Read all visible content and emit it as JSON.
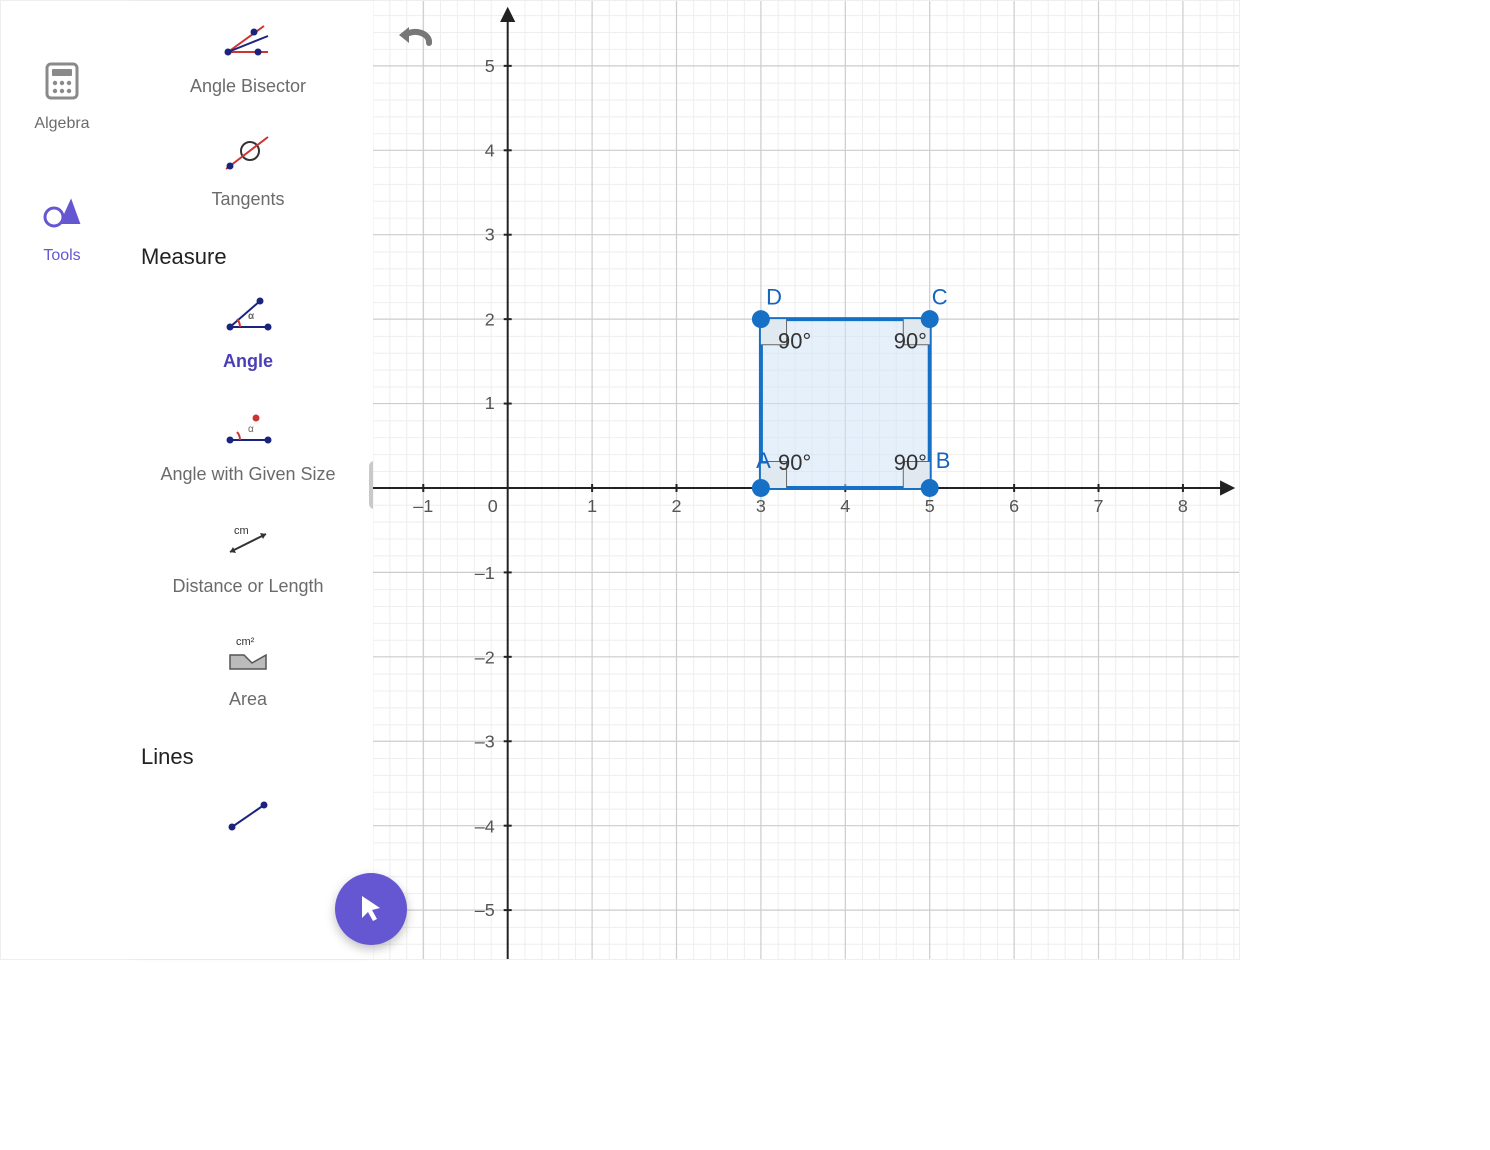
{
  "nav": {
    "algebra_label": "Algebra",
    "tools_label": "Tools"
  },
  "tools_panel": {
    "angle_bisector": "Angle Bisector",
    "tangents": "Tangents",
    "section_measure": "Measure",
    "angle": "Angle",
    "angle_with_given_size": "Angle with Given Size",
    "distance_or_length": "Distance or Length",
    "area": "Area",
    "section_lines": "Lines",
    "segment": "Segment"
  },
  "canvas": {
    "points": {
      "A": "A",
      "B": "B",
      "C": "C",
      "D": "D"
    },
    "angles": {
      "A": "90°",
      "B": "90°",
      "C": "90°",
      "D": "90°"
    },
    "x_ticks": [
      "–1",
      "0",
      "1",
      "2",
      "3",
      "4",
      "5",
      "6",
      "7",
      "8"
    ],
    "y_ticks_pos": [
      "1",
      "2",
      "3",
      "4",
      "5"
    ],
    "y_ticks_neg": [
      "–1",
      "–2",
      "–3",
      "–4",
      "–5"
    ]
  },
  "chart_data": {
    "type": "diagram",
    "title": "",
    "description": "Coordinate grid with a filled square ABCD and four right-angle markers",
    "x_range": [
      -1,
      8
    ],
    "y_range": [
      -5,
      5
    ],
    "grid_major": 1,
    "points": {
      "A": {
        "x": 3,
        "y": 0
      },
      "B": {
        "x": 5,
        "y": 0
      },
      "C": {
        "x": 5,
        "y": 2
      },
      "D": {
        "x": 3,
        "y": 2
      }
    },
    "polygon": [
      "A",
      "B",
      "C",
      "D"
    ],
    "angles_deg": {
      "A": 90,
      "B": 90,
      "C": 90,
      "D": 90
    }
  }
}
